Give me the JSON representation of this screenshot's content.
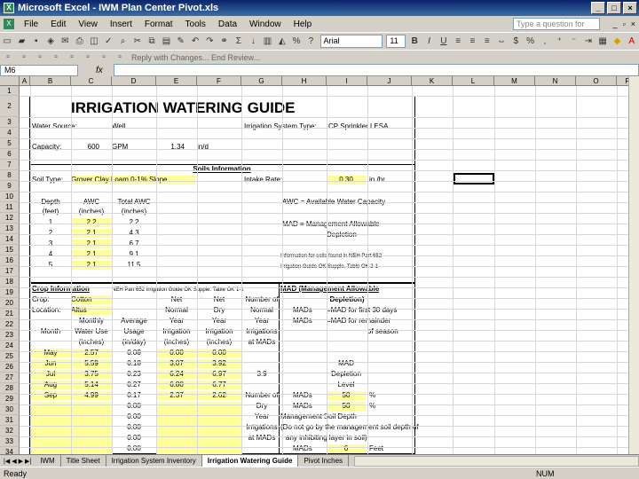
{
  "window": {
    "title": "Microsoft Excel - IWM Plan Center Pivot.xls"
  },
  "menu": {
    "items": [
      "File",
      "Edit",
      "View",
      "Insert",
      "Format",
      "Tools",
      "Data",
      "Window",
      "Help"
    ],
    "help_placeholder": "Type a question for help"
  },
  "toolbar": {
    "font": "Arial",
    "size": "11",
    "reply_text": "Reply with Changes...   End Review..."
  },
  "formula_bar": {
    "name_box": "M6",
    "fx": "fx",
    "formula": ""
  },
  "columns": [
    "A",
    "B",
    "C",
    "D",
    "E",
    "F",
    "G",
    "H",
    "I",
    "J",
    "K",
    "L",
    "M",
    "N",
    "O",
    "P"
  ],
  "rows": [
    "1",
    "2",
    "3",
    "4",
    "5",
    "6",
    "7",
    "8",
    "9",
    "10",
    "11",
    "12",
    "13",
    "14",
    "15",
    "16",
    "17",
    "18",
    "19",
    "20",
    "21",
    "22",
    "23",
    "24",
    "25",
    "26",
    "27",
    "28",
    "29",
    "30",
    "31",
    "32",
    "33",
    "34"
  ],
  "sheet": {
    "title": "IRRIGATION WATERING GUIDE",
    "water_source_label": "Water Source:",
    "water_source": "Well",
    "irrigation_system_label": "Irrigation System Type:",
    "irrigation_system": "CP Sprinkler LESA",
    "capacity_label": "Capacity:",
    "capacity": "600",
    "capacity_unit": "GPM",
    "rate": "1.34",
    "rate_unit": "in/d",
    "soils_header": "Soils Information",
    "soil_type_label": "Soil Type:",
    "soil_type": "Grover Clay Loam 0-1% Slope",
    "intake_label": "Intake Rate:",
    "intake_value": "0.30",
    "intake_unit": "in./hr.",
    "soil_table_headers": [
      [
        "Depth",
        "(feet)"
      ],
      [
        "AWC",
        "(inches)"
      ],
      [
        "Total AWC",
        "(inches)"
      ]
    ],
    "soil_rows": [
      [
        "1",
        "2.2",
        "2.2"
      ],
      [
        "2",
        "2.1",
        "4.3"
      ],
      [
        "3",
        "2.1",
        "6.7"
      ],
      [
        "4",
        "2.1",
        "9.1"
      ],
      [
        "5",
        "2.1",
        "11.5"
      ]
    ],
    "awc_note": "AWC = Available Water Capacity",
    "mad_note1": "MAD = Management Allowable",
    "mad_note2": "Depletion",
    "info_note1": "Information for soils found in NEH Part 652",
    "info_note2": "Irrigation Guide OK Supple. Table OK 2-1",
    "crop_header": "Crop Information",
    "crop_ref": "NEH Part 652 Irrigation Guide OK Supple. Table OK 1-1",
    "mad_header": "MAD (Management Allowable",
    "mad_header2": "Depletion)",
    "crop_label": "Crop:",
    "crop": "Cotton",
    "location_label": "Location:",
    "location": "Altus",
    "col_headers": [
      [
        "Month",
        "",
        ""
      ],
      [
        "Monthly",
        "Water Use",
        "(inches)"
      ],
      [
        "Average",
        "Usage",
        "(in/day)"
      ],
      [
        "Net",
        "Normal",
        "Year",
        "Irrigation",
        "(inches)"
      ],
      [
        "Net",
        "Dry",
        "Year",
        "Irrigation",
        "(inches)"
      ],
      [
        "Number of",
        "Normal",
        "Year",
        "Irrigations",
        "at MADs"
      ]
    ],
    "mad_col": [
      "MADs",
      "MADs"
    ],
    "mad_desc": [
      "=MAD for first 30 days",
      "=MAD for remainder",
      "of season"
    ],
    "crop_rows": [
      [
        "May",
        "2.57",
        "0.08",
        "0.00",
        "0.00",
        ""
      ],
      [
        "Jun",
        "5.59",
        "0.18",
        "3.07",
        "3.92",
        ""
      ],
      [
        "Jul",
        "3.75",
        "0.23",
        "6.24",
        "6.97",
        "3.9"
      ],
      [
        "Aug",
        "5.14",
        "0.27",
        "6.80",
        "6.77",
        ""
      ],
      [
        "Sep",
        "4.99",
        "0.17",
        "2.37",
        "2.62",
        ""
      ]
    ],
    "extra_avg": [
      "0.00",
      "0.00",
      "0.00",
      "0.00",
      "0.00",
      "0.00"
    ],
    "mad_label": "MAD",
    "depletion_label": "Depletion",
    "level_label": "Level",
    "mads_rows": [
      [
        "MADs",
        "50",
        "%"
      ],
      [
        "MADs",
        "50",
        "%"
      ]
    ],
    "dry_col": [
      "Number of",
      "Dry",
      "Year",
      "Irrigations",
      "at MADs"
    ],
    "soil_depth_label": "Management Soil Depth",
    "soil_depth_note1": "(Do not go by the management soil depth of",
    "soil_depth_note2": "any inhibiting layer in soil)",
    "mad_bottom": [
      "MADs",
      "6",
      "Feet"
    ]
  },
  "tabs": [
    "IWM",
    "Title Sheet",
    "Irrigation System Inventory",
    "Irrigation Watering Guide",
    "Pivot Inches"
  ],
  "active_tab": "Irrigation Watering Guide",
  "status": {
    "ready": "Ready",
    "num": "NUM"
  }
}
